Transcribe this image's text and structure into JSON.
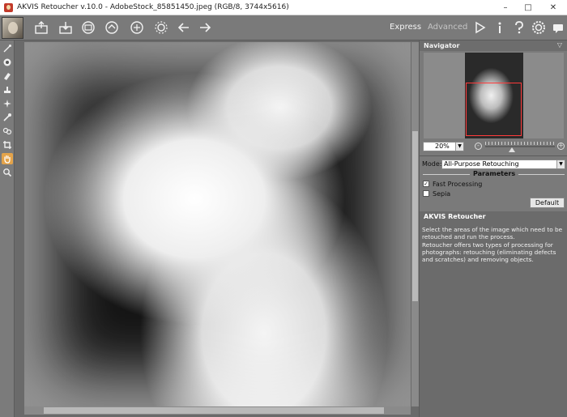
{
  "window": {
    "title": "AKVIS Retoucher v.10.0 - AdobeStock_85851450.jpeg (RGB/8, 3744x5616)",
    "minimize": "–",
    "maximize": "□",
    "close": "✕"
  },
  "toolbar": {
    "modes": [
      "Express",
      "Advanced"
    ],
    "active_mode": "Express",
    "icons": [
      "open-icon",
      "save-icon",
      "print-icon",
      "share-icon",
      "batch-icon",
      "settings-gear-icon",
      "undo-arrow-icon",
      "redo-arrow-icon",
      "run-icon",
      "info-icon",
      "help-icon",
      "preferences-icon",
      "chat-icon"
    ]
  },
  "tools": [
    "magic-wand-icon",
    "circle-brush-icon",
    "eraser-icon",
    "stamp-icon",
    "spot-healing-icon",
    "pipette-icon",
    "chain-icon",
    "crop-icon",
    "hand-icon",
    "zoom-icon"
  ],
  "navigator": {
    "title": "Navigator",
    "zoom": "20%",
    "zoom_fraction": 0.38
  },
  "settings": {
    "mode_label": "Mode:",
    "mode_value": "All-Purpose Retouching",
    "parameters_label": "Parameters",
    "fast_processing_label": "Fast Processing",
    "fast_processing_checked": true,
    "sepia_label": "Sepia",
    "sepia_checked": false,
    "default_button": "Default"
  },
  "help": {
    "title": "AKVIS Retoucher",
    "lines": [
      "Select the areas of the image which need to be retouched and run the process.",
      "Retoucher offers two types of processing for photographs: retouching (eliminating defects and scratches) and removing objects."
    ]
  },
  "colors": {
    "panel": "#7a7a7a",
    "help_bg": "#6b6b6b",
    "nav_frame": "#ff3a3a",
    "active_tool": "#e3a34a"
  }
}
